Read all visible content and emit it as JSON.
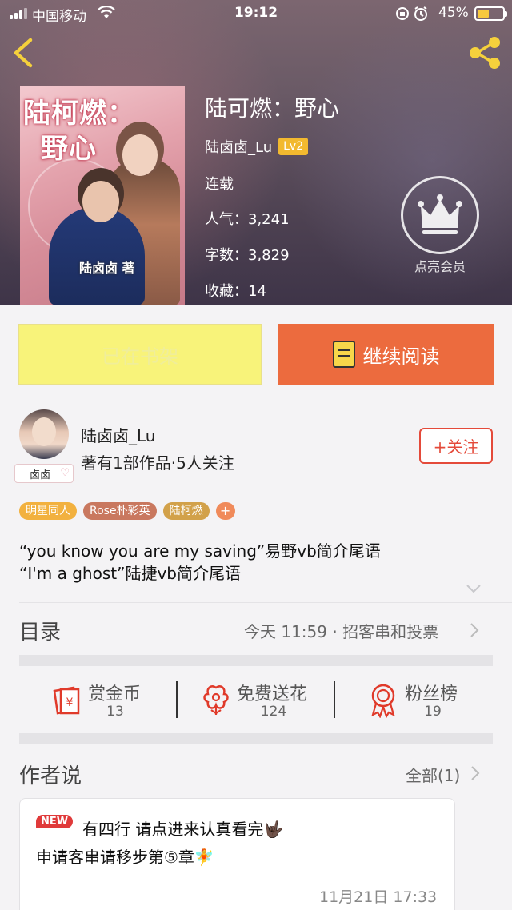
{
  "status_bar": {
    "carrier": "中国移动",
    "time": "19:12",
    "battery": "45%",
    "battery_level": 0.45
  },
  "header": {
    "back_icon": "chevron-left-icon",
    "share_icon": "share-icon",
    "icon_color": "#f5d13c"
  },
  "book": {
    "title": "陆可燃：野心",
    "author": "陆卤卤_Lu",
    "level": "Lv2",
    "status": "连载",
    "popularity_label": "人气：",
    "popularity": "3,241",
    "words_label": "字数：",
    "words": "3,829",
    "favorites_label": "收藏：",
    "favorites": "14",
    "cover_title_line1": "陆柯燃：",
    "cover_title_line2": "野心",
    "cover_author": "陆卤卤 著"
  },
  "vip": {
    "label": "点亮会员",
    "icon": "crown-icon"
  },
  "actions": {
    "shelf_label": "已在书架",
    "read_label": "继续阅读",
    "accent": "#ec6b3e",
    "shelf_color": "#f8f37a"
  },
  "author_card": {
    "name": "陆卤卤_Lu",
    "stats": "著有1部作品·5人关注",
    "avatar_tag": "卤卤",
    "follow_label": "+关注",
    "follow_color": "#e44a3a"
  },
  "tags": [
    {
      "label": "明星同人",
      "color": "#f2b13f"
    },
    {
      "label": "Rose朴彩英",
      "color": "#c9785f"
    },
    {
      "label": "陆柯燃",
      "color": "#d2a14a"
    }
  ],
  "tag_add": "+",
  "description": {
    "line1": "“you know you are my saving”易野vb简介尾语",
    "line2": "“I'm a ghost”陆捷vb简介尾语"
  },
  "toc": {
    "label": "目录",
    "update": "今天 11:59 · 招客串和投票"
  },
  "stats": [
    {
      "label": "赏金币",
      "value": "13",
      "icon": "red-envelope-icon"
    },
    {
      "label": "免费送花",
      "value": "124",
      "icon": "flower-icon"
    },
    {
      "label": "粉丝榜",
      "value": "19",
      "icon": "ribbon-medal-icon"
    }
  ],
  "author_says": {
    "label": "作者说",
    "all_link": "全部(1)",
    "new_badge": "NEW",
    "line1": "有四行 请点进来认真看完🤟🏿",
    "line2": "申请客串请移步第⑤章🧚",
    "time": "11月21日  17:33"
  }
}
